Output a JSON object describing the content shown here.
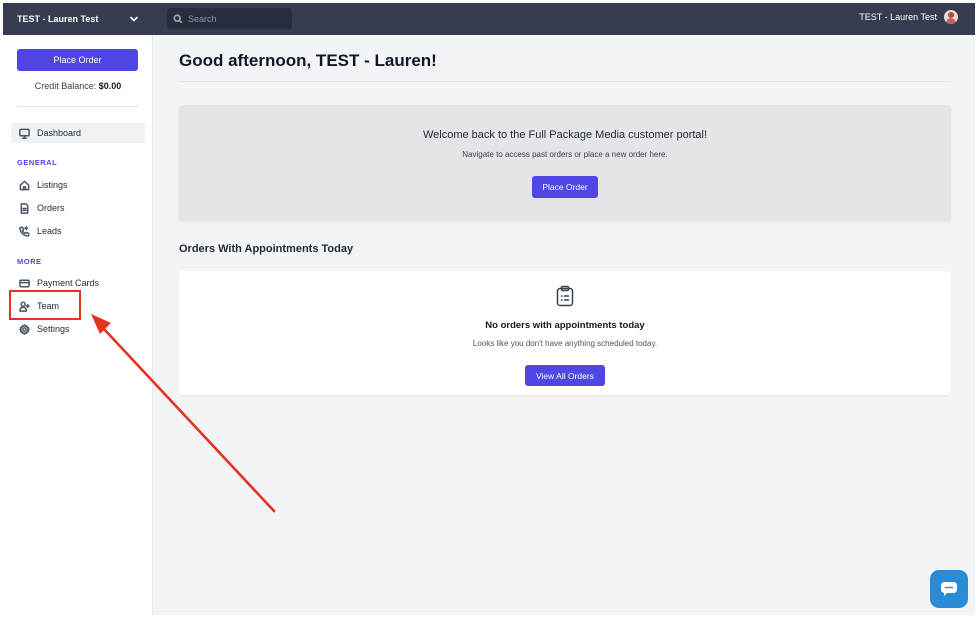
{
  "sidebar": {
    "account_name": "TEST - Lauren Test",
    "place_order_label": "Place Order",
    "credit_label": "Credit Balance:",
    "credit_value": "$0.00",
    "dashboard_label": "Dashboard",
    "general_label": "GENERAL",
    "listings_label": "Listings",
    "orders_label": "Orders",
    "leads_label": "Leads",
    "more_label": "MORE",
    "payment_cards_label": "Payment Cards",
    "team_label": "Team",
    "settings_label": "Settings"
  },
  "topbar": {
    "search_placeholder": "Search",
    "user_name": "TEST - Lauren Test"
  },
  "main": {
    "greeting": "Good afternoon, TEST - Lauren!",
    "welcome_title": "Welcome back to the Full Package Media customer portal!",
    "welcome_subtitle": "Navigate to access past orders or place a new order here.",
    "welcome_button_label": "Place Order",
    "appointments_title": "Orders With Appointments Today",
    "empty_title": "No orders with appointments today",
    "empty_subtitle": "Looks like you don't have anything scheduled today.",
    "view_all_label": "View All Orders"
  },
  "colors": {
    "accent": "#4f46e5",
    "topbar": "#363d50",
    "highlight": "#e3341f",
    "chat": "#2a8bd6"
  }
}
